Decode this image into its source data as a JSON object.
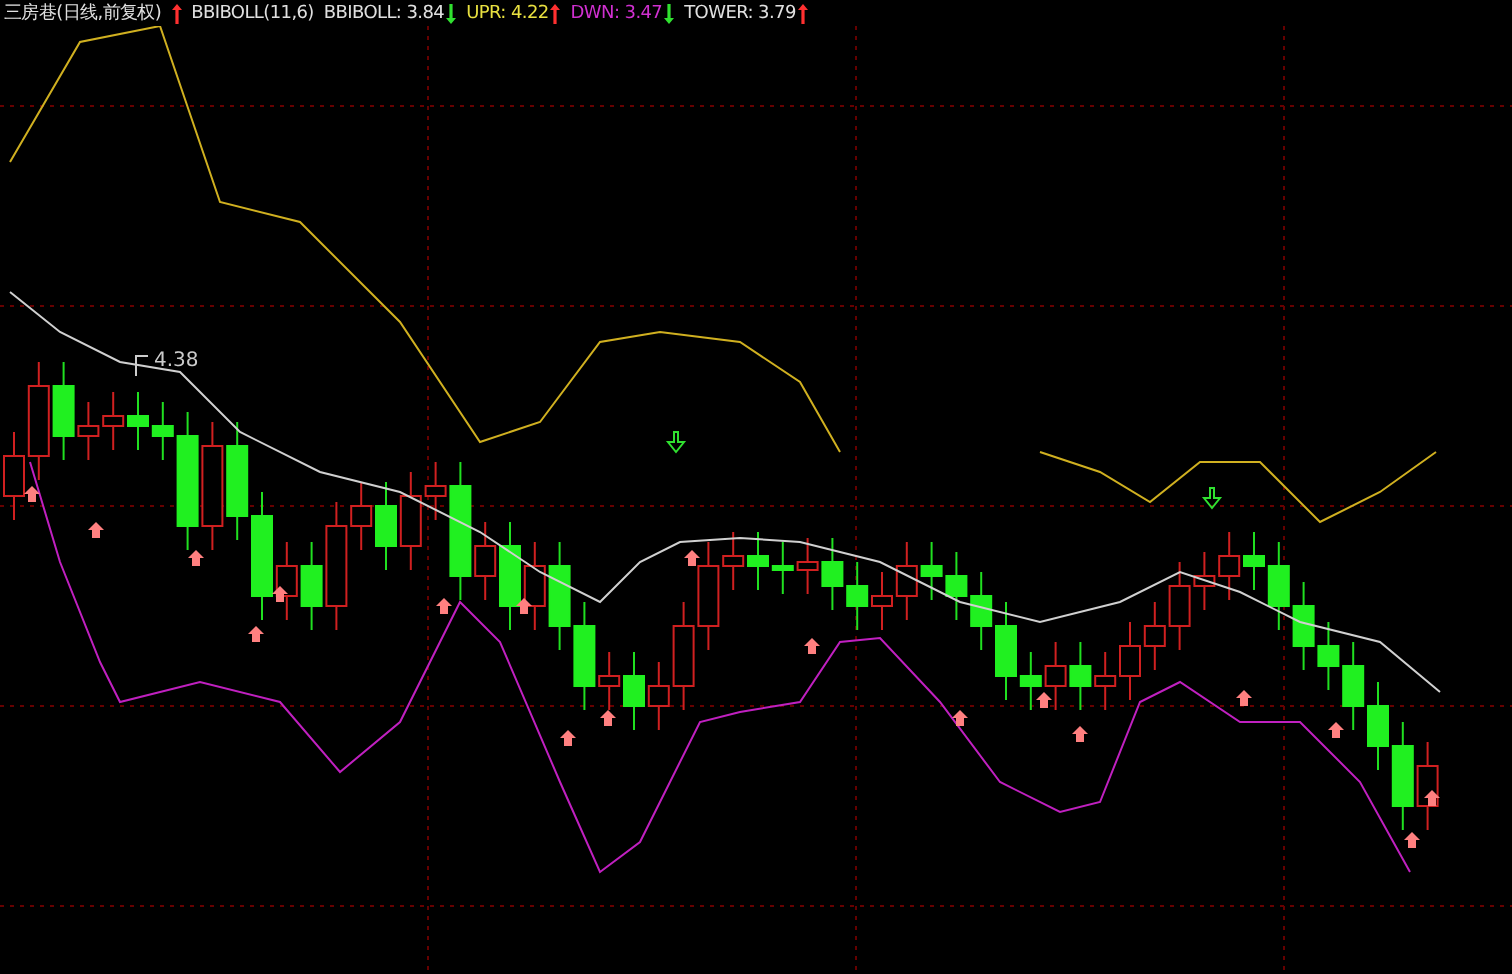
{
  "title": "三房巷(日线,前复权)",
  "indicator": {
    "name": "BBIBOLL(11,6)",
    "rising": true
  },
  "readings": [
    {
      "label": "BBIBOLL: ",
      "value": "3.84",
      "rising": false,
      "color": "#e0e0e0"
    },
    {
      "label": "UPR: ",
      "value": "4.22",
      "rising": true,
      "color": "#e8e040"
    },
    {
      "label": "DWN: ",
      "value": "3.47",
      "rising": false,
      "color": "#d030d0"
    },
    {
      "label": "TOWER: ",
      "value": "3.79",
      "rising": true,
      "color": "#e0e0e0"
    }
  ],
  "chart": {
    "peak_label": "4.38"
  }
}
